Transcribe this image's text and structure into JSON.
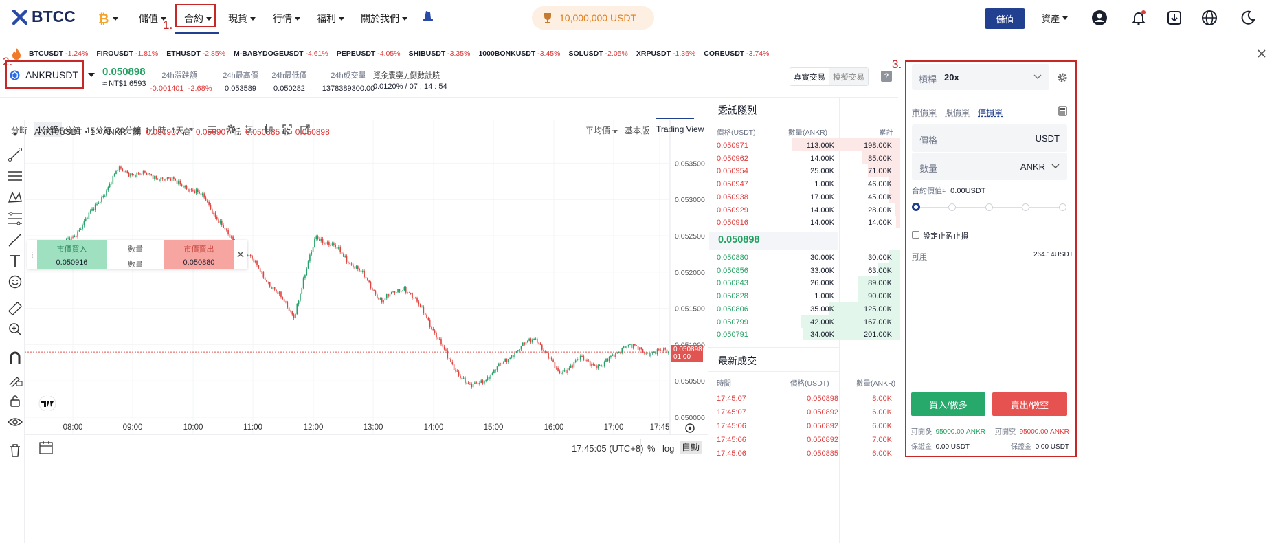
{
  "nav": {
    "brand": "BTCC",
    "items": [
      "儲值",
      "合約",
      "現貨",
      "行情",
      "福利",
      "關於我們"
    ],
    "promo": "10,000,000 USDT",
    "deposit": "儲值",
    "assets": "資產",
    "step1": "1."
  },
  "ticker": [
    {
      "s": "BTCUSDT",
      "c": "-1.24%"
    },
    {
      "s": "FIROUSDT",
      "c": "-1.81%"
    },
    {
      "s": "ETHUSDT",
      "c": "-2.85%"
    },
    {
      "s": "M-BABYDOGEUSDT",
      "c": "-4.61%"
    },
    {
      "s": "PEPEUSDT",
      "c": "-4.05%"
    },
    {
      "s": "SHIBUSDT",
      "c": "-3.35%"
    },
    {
      "s": "1000BONKUSDT",
      "c": "-3.45%"
    },
    {
      "s": "SOLUSDT",
      "c": "-2.05%"
    },
    {
      "s": "XRPUSDT",
      "c": "-1.36%"
    },
    {
      "s": "COREUSDT",
      "c": "-3.74%"
    }
  ],
  "market": {
    "step2": "2.",
    "symbol": "ANKRUSDT",
    "price": "0.050898",
    "fiat": "≈ NT$1.6593",
    "change_label": "24h漲跌額",
    "change": "-0.001401",
    "change_pct": "-2.68%",
    "high_label": "24h最高價",
    "high": "0.053589",
    "low_label": "24h最低價",
    "low": "0.050282",
    "vol_label": "24h成交量",
    "vol": "1378389300.00",
    "fund_label": "資金費率 / 倒數計時",
    "fund": "0.0120% / 07 : 14 : 54",
    "real": "真實交易",
    "demo": "模擬交易",
    "help": "?"
  },
  "chart_toolbar": {
    "tf": [
      "分時",
      "1分鐘",
      "5分鐘",
      "15分鐘",
      "30分鐘",
      "1小時",
      "1天"
    ],
    "avg": "平均價",
    "basic": "基本版",
    "tv": "Trading View"
  },
  "chart_data": {
    "type": "line",
    "title": "ANKR/USDT・1・ANKR",
    "ohlc": {
      "o_label": "開",
      "o": "0.050907",
      "h_label": "高",
      "h": "0.050907",
      "l_label": "低",
      "l": "0.050885",
      "c_label": "收",
      "c": "0.050898"
    },
    "x": [
      "07:30",
      "08:00",
      "08:30",
      "09:00",
      "09:20",
      "09:40",
      "10:00",
      "10:20",
      "10:40",
      "11:00",
      "11:20",
      "11:40",
      "12:00",
      "12:20",
      "12:40",
      "13:00",
      "13:20",
      "13:40",
      "14:00",
      "14:20",
      "14:40",
      "15:00",
      "15:20",
      "15:40",
      "16:00",
      "16:20",
      "16:40",
      "17:00",
      "17:20",
      "17:45"
    ],
    "y": [
      0.0521,
      0.05225,
      0.0525,
      0.0529,
      0.0534,
      0.05335,
      0.0533,
      0.0532,
      0.053,
      0.0525,
      0.0522,
      0.0518,
      0.0514,
      0.0525,
      0.0523,
      0.052,
      0.0516,
      0.0518,
      0.0514,
      0.0508,
      0.0504,
      0.0506,
      0.0509,
      0.0511,
      0.0506,
      0.0508,
      0.0507,
      0.051,
      0.0509,
      0.050898
    ],
    "ylim": [
      0.05,
      0.05375
    ],
    "yticks": [
      "0.053500",
      "0.053000",
      "0.052500",
      "0.052000",
      "0.051500",
      "0.051000",
      "0.050500",
      "0.050000"
    ],
    "xticks": [
      "08:00",
      "09:00",
      "10:00",
      "11:00",
      "12:00",
      "13:00",
      "14:00",
      "15:00",
      "16:00",
      "17:00",
      "17:45"
    ],
    "last": "0.050898",
    "countdown": "01:00"
  },
  "widget": {
    "buy_label": "市價買入",
    "buy": "0.050916",
    "qty": "數量",
    "sell_label": "市價賣出",
    "sell": "0.050880"
  },
  "chart_footer": {
    "time": "17:45:05 (UTC+8)",
    "pct": "%",
    "log": "log",
    "auto": "自動"
  },
  "orderbook": {
    "title": "委託隊列",
    "h_price": "價格(USDT)",
    "h_qty": "數量(ANKR)",
    "h_cum": "累計",
    "asks": [
      [
        "0.050971",
        "113.00K",
        "198.00K",
        0.57
      ],
      [
        "0.050962",
        "14.00K",
        "85.00K",
        0.2
      ],
      [
        "0.050954",
        "25.00K",
        "71.00K",
        0.17
      ],
      [
        "0.050947",
        "1.00K",
        "46.00K",
        0.06
      ],
      [
        "0.050938",
        "17.00K",
        "45.00K",
        0.06
      ],
      [
        "0.050929",
        "14.00K",
        "28.00K",
        0.03
      ],
      [
        "0.050916",
        "14.00K",
        "14.00K",
        0.02
      ]
    ],
    "mid": "0.050898",
    "bids": [
      [
        "0.050880",
        "30.00K",
        "30.00K",
        0.06
      ],
      [
        "0.050856",
        "33.00K",
        "63.00K",
        0.12
      ],
      [
        "0.050843",
        "26.00K",
        "89.00K",
        0.22
      ],
      [
        "0.050828",
        "1.00K",
        "90.00K",
        0.22
      ],
      [
        "0.050806",
        "35.00K",
        "125.00K",
        0.37
      ],
      [
        "0.050799",
        "42.00K",
        "167.00K",
        0.52
      ],
      [
        "0.050791",
        "34.00K",
        "201.00K",
        0.51
      ]
    ]
  },
  "trades": {
    "title": "最新成交",
    "h_time": "時間",
    "h_price": "價格(USDT)",
    "h_qty": "數量(ANKR)",
    "rows": [
      [
        "17:45:07",
        "0.050898",
        "8.00K"
      ],
      [
        "17:45:07",
        "0.050892",
        "6.00K"
      ],
      [
        "17:45:06",
        "0.050892",
        "6.00K"
      ],
      [
        "17:45:06",
        "0.050892",
        "7.00K"
      ],
      [
        "17:45:06",
        "0.050885",
        "6.00K"
      ]
    ]
  },
  "order": {
    "step3": "3.",
    "leverage_label": "槓桿",
    "leverage": "20x",
    "tabs": [
      "市價單",
      "限價單",
      "停損單"
    ],
    "price_label": "價格",
    "price_unit": "USDT",
    "qty_label": "數量",
    "qty_unit": "ANKR",
    "value_label": "合約價值≈",
    "value": "0.00USDT",
    "tpsl": "設定止盈止損",
    "avail_label": "可用",
    "avail": "264.14USDT",
    "buy": "買入/做多",
    "sell": "賣出/做空",
    "open_long_label": "可開多",
    "open_long": "95000.00 ANKR",
    "open_short_label": "可開空",
    "open_short": "95000.00 ANKR",
    "margin_label": "保證金",
    "margin_long": "0.00 USDT",
    "margin_short": "0.00 USDT"
  }
}
